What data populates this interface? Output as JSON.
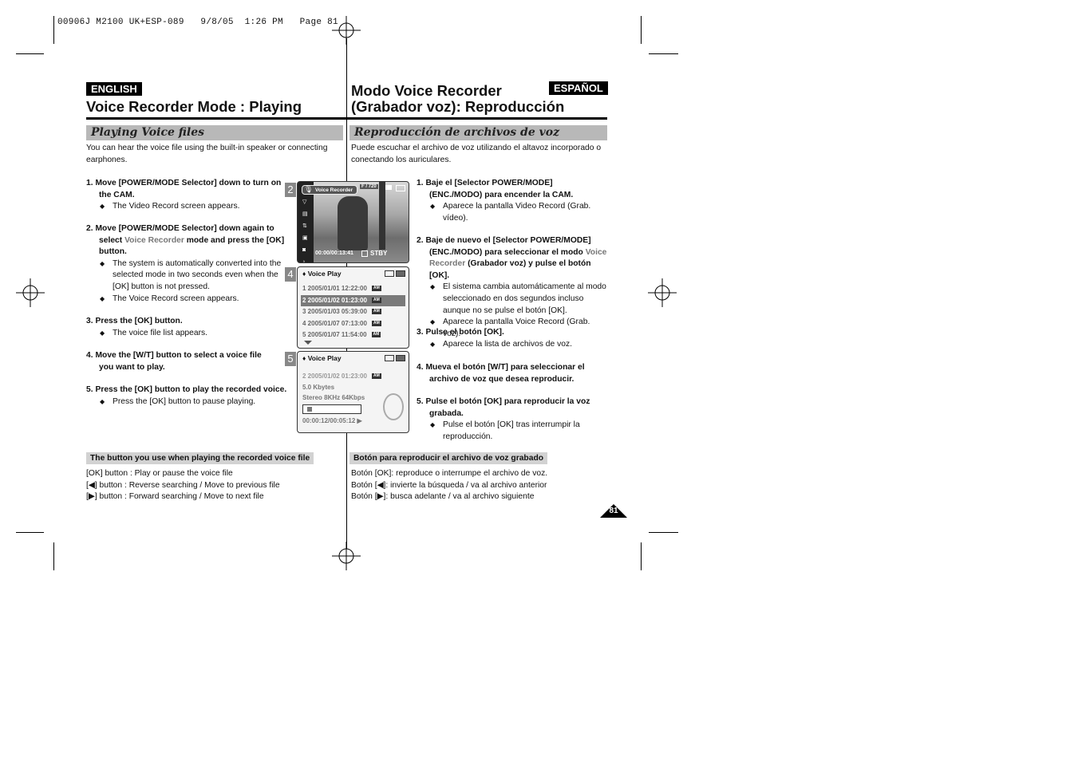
{
  "slug": "00906J M2100 UK+ESP-089   9/8/05  1:26 PM   Page 81",
  "page_number": "81",
  "en": {
    "badge": "ENGLISH",
    "title": "Voice Recorder Mode : Playing",
    "section": "Playing Voice files",
    "intro": "You can hear the voice file using the built-in speaker or connecting earphones.",
    "steps": [
      {
        "head": "1.  Move [POWER/MODE Selector] down to turn on the CAM.",
        "bullets": [
          "The Video Record screen appears."
        ]
      },
      {
        "head_a": "2.  Move [POWER/MODE Selector] down again to select ",
        "head_hl": "Voice Recorder",
        "head_b": " mode and press the [OK] button.",
        "bullets": [
          "The system is automatically converted into the selected mode in two seconds even when the [OK] button is not pressed.",
          "The Voice Record screen appears."
        ]
      },
      {
        "head": "3.  Press the [OK] button.",
        "bullets": [
          "The voice file list appears."
        ]
      },
      {
        "head": "4.  Move the [W/T] button to select a voice file you want to play.",
        "bullets": []
      },
      {
        "head": "5.  Press the [OK] button to play the recorded voice.",
        "bullets": [
          "Press the [OK] button to pause playing."
        ]
      }
    ],
    "note_title": "The button you use when playing the recorded voice file",
    "note_lines": [
      "[OK] button : Play or pause the voice file",
      "[◀] button : Reverse searching / Move to previous file",
      "[▶] button : Forward searching / Move to next file"
    ]
  },
  "es": {
    "badge": "ESPAÑOL",
    "title_line1": "Modo Voice Recorder",
    "title_line2": "(Grabador voz): Reproducción",
    "section": "Reproducción de archivos de voz",
    "intro": "Puede escuchar el archivo de voz utilizando el altavoz incorporado o conectando los auriculares.",
    "steps": [
      {
        "head": "1.  Baje el [Selector POWER/MODE] (ENC./MODO) para encender la CAM.",
        "bullets": [
          "Aparece la pantalla Video Record (Grab. vídeo)."
        ]
      },
      {
        "head_a": "2.  Baje de nuevo el [Selector POWER/MODE] (ENC./MODO) para seleccionar el modo ",
        "head_hl": "Voice Recorder",
        "head_b": " (Grabador voz) y pulse el botón [OK].",
        "bullets": [
          "El sistema cambia automáticamente al modo seleccionado en dos segundos incluso aunque no se pulse el botón [OK].",
          "Aparece la pantalla Voice Record (Grab. voz)."
        ]
      },
      {
        "head": "3.  Pulse el botón [OK].",
        "bullets": [
          "Aparece la lista de archivos de voz."
        ]
      },
      {
        "head": "4.  Mueva el botón [W/T] para seleccionar el archivo de voz que desea reproducir.",
        "bullets": []
      },
      {
        "head": "5.  Pulse el botón [OK] para reproducir la voz grabada.",
        "bullets": [
          "Pulse el botón [OK] tras interrumpir la reproducción."
        ]
      }
    ],
    "note_title": "Botón para reproducir el archivo de voz grabado",
    "note_lines": [
      "Botón [OK]: reproduce o interrumpe el archivo de voz.",
      "Botón [◀]: invierte la búsqueda / va al archivo anterior",
      "Botón [▶]: busca adelante / va al archivo siguiente"
    ]
  },
  "screens": {
    "s2": {
      "num": "2",
      "mode": "Voice Recorder",
      "quality": "F / 720",
      "time": "00:00/00:13:41",
      "status": "STBY"
    },
    "s4": {
      "num": "4",
      "title": "Voice Play",
      "rows": [
        "1  2005/01/01   12:22:00",
        "2  2005/01/02   01:23:00",
        "3  2005/01/03   05:39:00",
        "4  2005/01/07   07:13:00",
        "5  2005/01/07   11:54:00"
      ],
      "selected_index": 1
    },
    "s5": {
      "num": "5",
      "title": "Voice Play",
      "file": "2  2005/01/02 01:23:00",
      "size": "5.0 Kbytes",
      "format": "Stereo  8KHz  64Kbps",
      "time": "00:00:12/00:05:12 ▶",
      "progress": 0.04
    }
  }
}
